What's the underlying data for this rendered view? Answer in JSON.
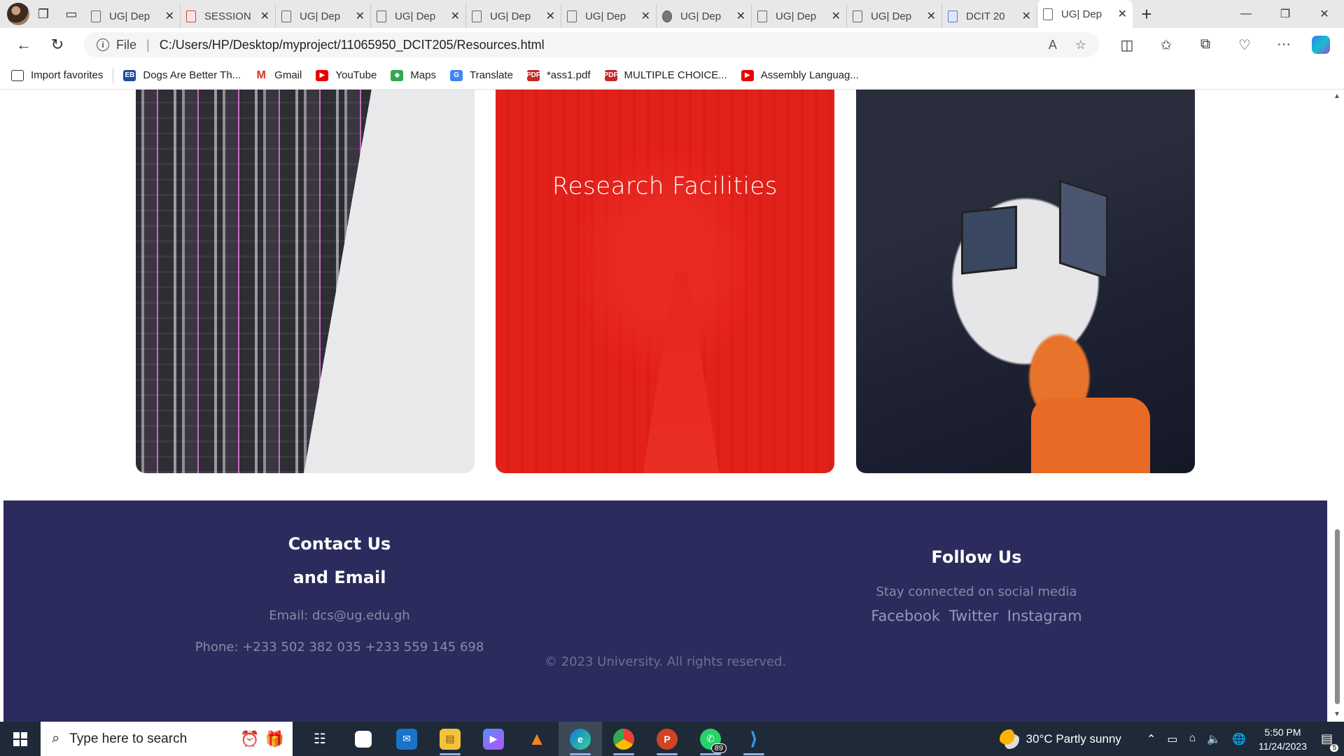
{
  "browser": {
    "tabs": [
      {
        "title": "UG| Dep",
        "icon": "page-icon"
      },
      {
        "title": "SESSION",
        "icon": "pdf-icon"
      },
      {
        "title": "UG| Dep",
        "icon": "page-icon"
      },
      {
        "title": "UG| Dep",
        "icon": "page-icon"
      },
      {
        "title": "UG| Dep",
        "icon": "page-icon"
      },
      {
        "title": "UG| Dep",
        "icon": "page-icon"
      },
      {
        "title": "UG| Dep",
        "icon": "gear-icon"
      },
      {
        "title": "UG| Dep",
        "icon": "page-icon"
      },
      {
        "title": "UG| Dep",
        "icon": "page-icon"
      },
      {
        "title": "DCIT 20",
        "icon": "doc-icon"
      },
      {
        "title": "UG| Dep",
        "icon": "page-icon",
        "active": true
      }
    ],
    "address": {
      "scheme": "File",
      "url": "C:/Users/HP/Desktop/myproject/11065950_DCIT205/Resources.html"
    },
    "favorites": [
      {
        "label": "Import favorites",
        "icon": "import-icon"
      },
      {
        "label": "Dogs Are Better Th...",
        "icon": "eb-icon"
      },
      {
        "label": "Gmail",
        "icon": "gmail-icon"
      },
      {
        "label": "YouTube",
        "icon": "youtube-icon"
      },
      {
        "label": "Maps",
        "icon": "maps-icon"
      },
      {
        "label": "Translate",
        "icon": "translate-icon"
      },
      {
        "label": "*ass1.pdf",
        "icon": "pdf-icon"
      },
      {
        "label": "MULTIPLE CHOICE...",
        "icon": "pdf-icon"
      },
      {
        "label": "Assembly Languag...",
        "icon": "youtube-icon"
      }
    ]
  },
  "page": {
    "cards": [
      {
        "name": "servers-card",
        "caption": ""
      },
      {
        "name": "research-facilities-card",
        "caption": "Research Facilities"
      },
      {
        "name": "students-card",
        "caption": ""
      }
    ],
    "footer": {
      "contact_title_line1": "Contact Us",
      "contact_title_line2": "and Email",
      "email": "Email: dcs@ug.edu.gh",
      "phone": "Phone: +233 502 382 035 +233 559 145 698",
      "follow_title": "Follow Us",
      "follow_tagline": "Stay connected on social media",
      "social": [
        "Facebook",
        "Twitter",
        "Instagram"
      ],
      "copyright": "© 2023 University. All rights reserved."
    }
  },
  "taskbar": {
    "search_placeholder": "Type here to search",
    "apps": [
      {
        "name": "task-view",
        "running": false
      },
      {
        "name": "microsoft-store",
        "running": false
      },
      {
        "name": "mail",
        "running": false
      },
      {
        "name": "file-explorer",
        "running": true
      },
      {
        "name": "app-hexagon",
        "running": false
      },
      {
        "name": "vlc",
        "running": false
      },
      {
        "name": "edge",
        "running": true,
        "active": true
      },
      {
        "name": "chrome",
        "running": true
      },
      {
        "name": "powerpoint",
        "running": true
      },
      {
        "name": "whatsapp",
        "running": true,
        "badge": "89"
      },
      {
        "name": "vscode",
        "running": true
      }
    ],
    "weather": "30°C  Partly sunny",
    "time": "5:50 PM",
    "date": "11/24/2023",
    "notification_count": "5"
  },
  "colors": {
    "footer_bg": "#2b2b5d",
    "accent_red": "#e61e19"
  }
}
